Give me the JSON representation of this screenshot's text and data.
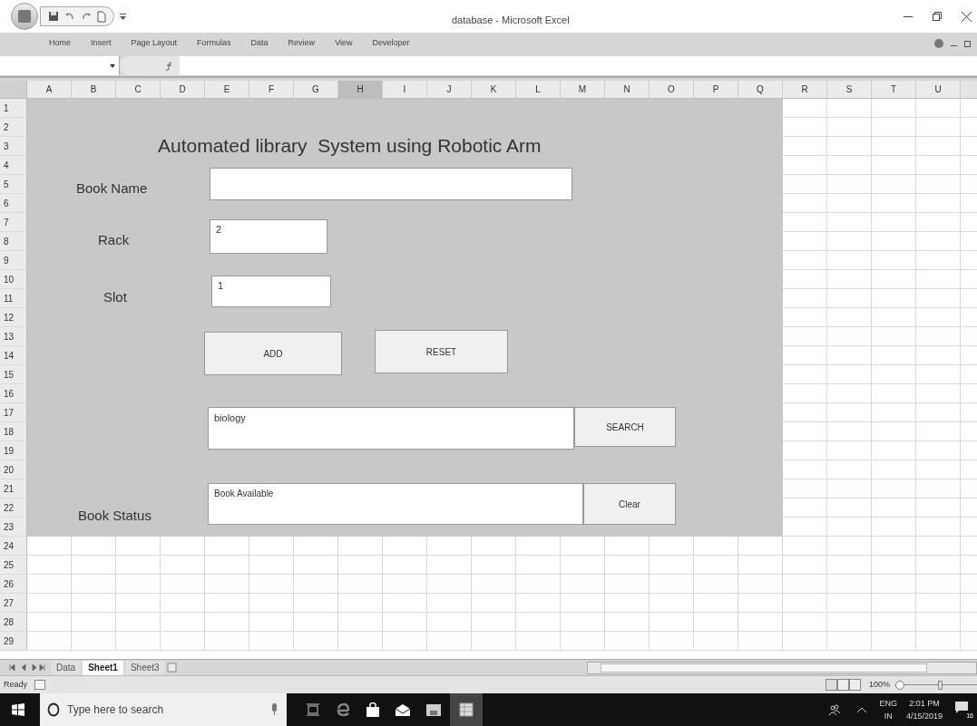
{
  "window": {
    "title": "database - Microsoft Excel"
  },
  "ribbon_tabs": [
    "Home",
    "Insert",
    "Page Layout",
    "Formulas",
    "Data",
    "Review",
    "View",
    "Developer"
  ],
  "columns": [
    {
      "label": "A",
      "selected": false
    },
    {
      "label": "B",
      "selected": false
    },
    {
      "label": "C",
      "selected": false
    },
    {
      "label": "D",
      "selected": false
    },
    {
      "label": "E",
      "selected": false
    },
    {
      "label": "F",
      "selected": false
    },
    {
      "label": "G",
      "selected": false
    },
    {
      "label": "H",
      "selected": true
    },
    {
      "label": "I",
      "selected": false
    },
    {
      "label": "J",
      "selected": false
    },
    {
      "label": "K",
      "selected": false
    },
    {
      "label": "L",
      "selected": false
    },
    {
      "label": "M",
      "selected": false
    },
    {
      "label": "N",
      "selected": false
    },
    {
      "label": "O",
      "selected": false
    },
    {
      "label": "P",
      "selected": false
    },
    {
      "label": "Q",
      "selected": false
    },
    {
      "label": "R",
      "selected": false
    },
    {
      "label": "S",
      "selected": false
    },
    {
      "label": "T",
      "selected": false
    },
    {
      "label": "U",
      "selected": false
    }
  ],
  "rows": [
    "1",
    "2",
    "3",
    "4",
    "5",
    "6",
    "7",
    "8",
    "9",
    "10",
    "11",
    "12",
    "13",
    "14",
    "15",
    "16",
    "17",
    "18",
    "19",
    "20",
    "21",
    "22",
    "23",
    "24",
    "25",
    "26",
    "27",
    "28",
    "29"
  ],
  "form": {
    "title": "Automated library  System using Robotic Arm",
    "book_name": {
      "label": "Book Name"
    },
    "rack": {
      "label": "Rack",
      "value": "2"
    },
    "slot": {
      "label": "Slot",
      "value": "1"
    },
    "add_button": "ADD",
    "reset_button": "RESET",
    "search": {
      "value": "biology",
      "button": "SEARCH"
    },
    "status": {
      "label": "Book Status",
      "value": "Book Available",
      "button": "Clear"
    }
  },
  "sheet_tabs": [
    {
      "label": "Data",
      "selected": false
    },
    {
      "label": "Sheet1",
      "selected": true
    },
    {
      "label": "Sheet3",
      "selected": false
    }
  ],
  "status_bar": {
    "mode": "Ready",
    "zoom": "100%",
    "zoom_slider": {
      "level": 0.55
    }
  },
  "taskbar": {
    "search_placeholder": "Type here to search",
    "language": "ENG",
    "region": "IN",
    "time": "2:01 PM",
    "date": "4/15/2019",
    "notifications": "16"
  }
}
